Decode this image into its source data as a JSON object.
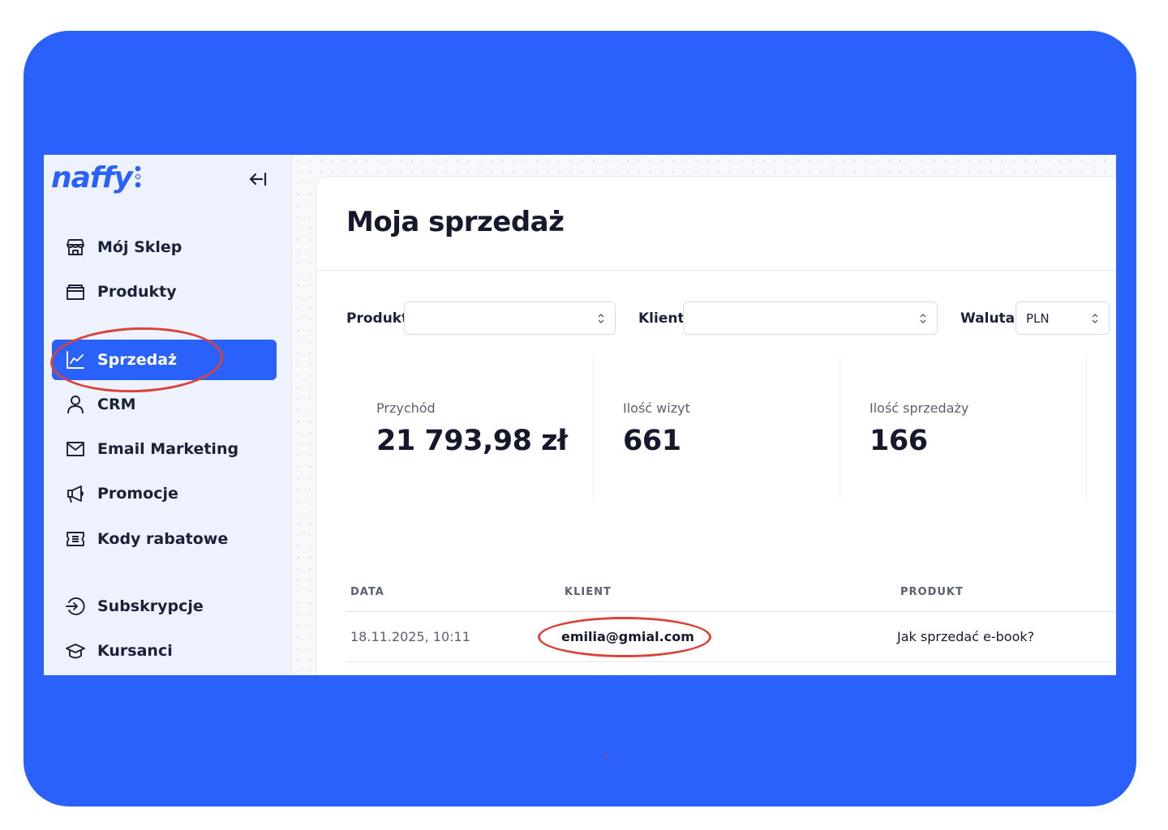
{
  "brand": {
    "logo_text": "naffy",
    "accent": "#2b61fb",
    "frame_bg": "#2b61fb",
    "annotation_color": "#d9443a"
  },
  "sidebar": {
    "collapse_icon": "collapse-left-icon",
    "items": [
      {
        "label": "Mój Sklep",
        "icon": "store-icon"
      },
      {
        "label": "Produkty",
        "icon": "folder-icon"
      },
      {
        "label": "Sprzedaż",
        "icon": "chart-line-icon",
        "active": true
      },
      {
        "label": "CRM",
        "icon": "user-icon"
      },
      {
        "label": "Email Marketing",
        "icon": "mail-icon"
      },
      {
        "label": "Promocje",
        "icon": "megaphone-icon"
      },
      {
        "label": "Kody rabatowe",
        "icon": "ticket-icon"
      },
      {
        "label": "Subskrypcje",
        "icon": "subscription-icon"
      },
      {
        "label": "Kursanci",
        "icon": "graduation-cap-icon"
      }
    ]
  },
  "main": {
    "title": "Moja sprzedaż",
    "filters": {
      "product_label": "Produkt",
      "product_value": "",
      "client_label": "Klient",
      "client_value": "",
      "currency_label": "Waluta",
      "currency_value": "PLN"
    },
    "stats": [
      {
        "label": "Przychód",
        "value": "21 793,98 zł"
      },
      {
        "label": "Ilość wizyt",
        "value": "661"
      },
      {
        "label": "Ilość sprzedaży",
        "value": "166"
      }
    ],
    "table": {
      "headers": [
        "DATA",
        "KLIENT",
        "PRODUKT"
      ],
      "rows": [
        {
          "date": "18.11.2025, 10:11",
          "client": "emilia@gmial.com",
          "product": "Jak sprzedać e-book?"
        }
      ]
    }
  }
}
